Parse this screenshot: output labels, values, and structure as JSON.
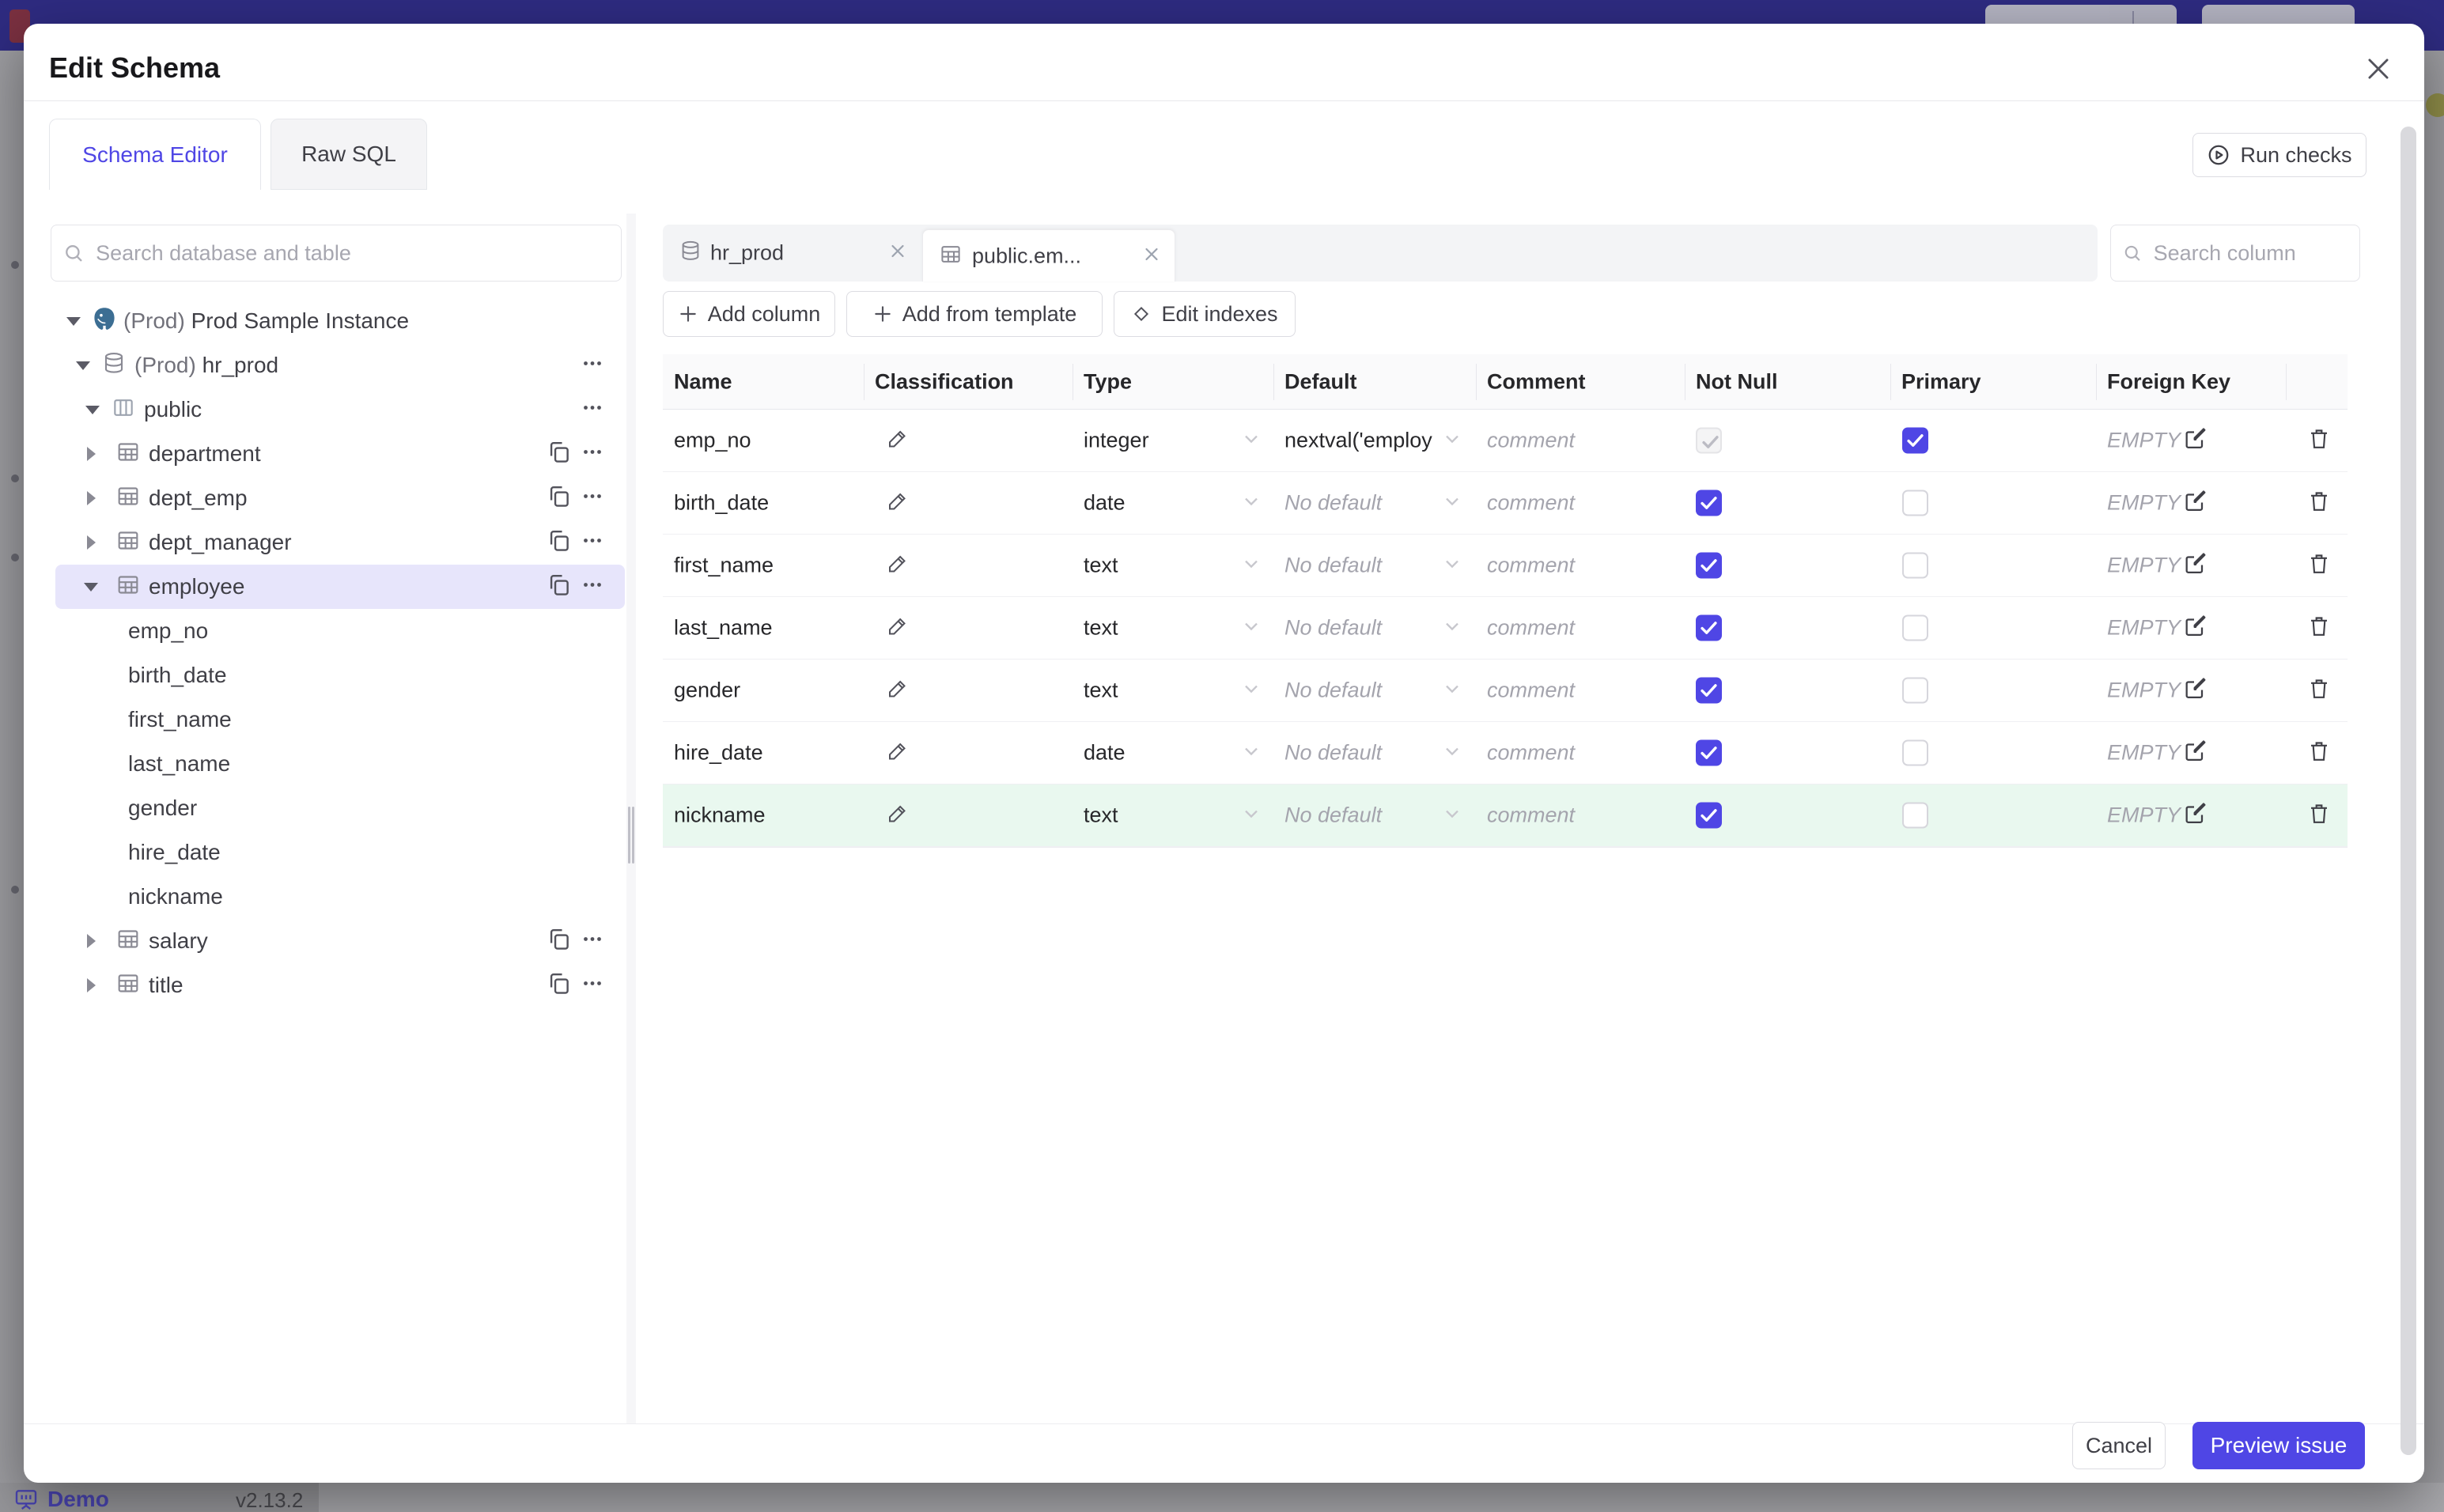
{
  "backdrop": {
    "demo_label": "Demo",
    "version": "v2.13.2"
  },
  "modal": {
    "title": "Edit Schema",
    "tabs": {
      "schema_editor": "Schema Editor",
      "raw_sql": "Raw SQL"
    },
    "run_checks": "Run checks"
  },
  "sidebar": {
    "search_placeholder": "Search database and table",
    "tree": [
      {
        "prefix": "(Prod)",
        "name": "Prod Sample Instance"
      },
      {
        "prefix": "(Prod)",
        "name": "hr_prod"
      },
      {
        "prefix": "",
        "name": "public"
      },
      {
        "prefix": "",
        "name": "department"
      },
      {
        "prefix": "",
        "name": "dept_emp"
      },
      {
        "prefix": "",
        "name": "dept_manager"
      },
      {
        "prefix": "",
        "name": "employee"
      },
      {
        "prefix": "",
        "name": "emp_no"
      },
      {
        "prefix": "",
        "name": "birth_date"
      },
      {
        "prefix": "",
        "name": "first_name"
      },
      {
        "prefix": "",
        "name": "last_name"
      },
      {
        "prefix": "",
        "name": "gender"
      },
      {
        "prefix": "",
        "name": "hire_date"
      },
      {
        "prefix": "",
        "name": "nickname"
      },
      {
        "prefix": "",
        "name": "salary"
      },
      {
        "prefix": "",
        "name": "title"
      }
    ]
  },
  "editor": {
    "tabs": [
      {
        "label": "hr_prod"
      },
      {
        "label": "public.em..."
      }
    ],
    "search_placeholder": "Search column",
    "add_column": "Add column",
    "add_from_template": "Add from template",
    "edit_indexes": "Edit indexes"
  },
  "table": {
    "headers": [
      "Name",
      "Classification",
      "Type",
      "Default",
      "Comment",
      "Not Null",
      "Primary",
      "Foreign Key"
    ],
    "comment_placeholder": "comment",
    "fk_empty": "EMPTY",
    "rows": [
      {
        "name": "emp_no",
        "type": "integer",
        "default": "nextval('employ",
        "not_null": true,
        "not_null_disabled": true,
        "primary": true,
        "highlight": false
      },
      {
        "name": "birth_date",
        "type": "date",
        "default": "No default",
        "not_null": true,
        "not_null_disabled": false,
        "primary": false,
        "highlight": false
      },
      {
        "name": "first_name",
        "type": "text",
        "default": "No default",
        "not_null": true,
        "not_null_disabled": false,
        "primary": false,
        "highlight": false
      },
      {
        "name": "last_name",
        "type": "text",
        "default": "No default",
        "not_null": true,
        "not_null_disabled": false,
        "primary": false,
        "highlight": false
      },
      {
        "name": "gender",
        "type": "text",
        "default": "No default",
        "not_null": true,
        "not_null_disabled": false,
        "primary": false,
        "highlight": false
      },
      {
        "name": "hire_date",
        "type": "date",
        "default": "No default",
        "not_null": true,
        "not_null_disabled": false,
        "primary": false,
        "highlight": false
      },
      {
        "name": "nickname",
        "type": "text",
        "default": "No default",
        "not_null": true,
        "not_null_disabled": false,
        "primary": false,
        "highlight": true
      }
    ]
  },
  "footer": {
    "cancel": "Cancel",
    "preview": "Preview issue"
  },
  "colors": {
    "accent": "#4f46e5",
    "amber": "#c8790e",
    "green": "#16a34a",
    "green_row_bg": "#e9f8ef",
    "selected_row_bg": "#e7e5fb",
    "navbar": "#2e2b80"
  }
}
